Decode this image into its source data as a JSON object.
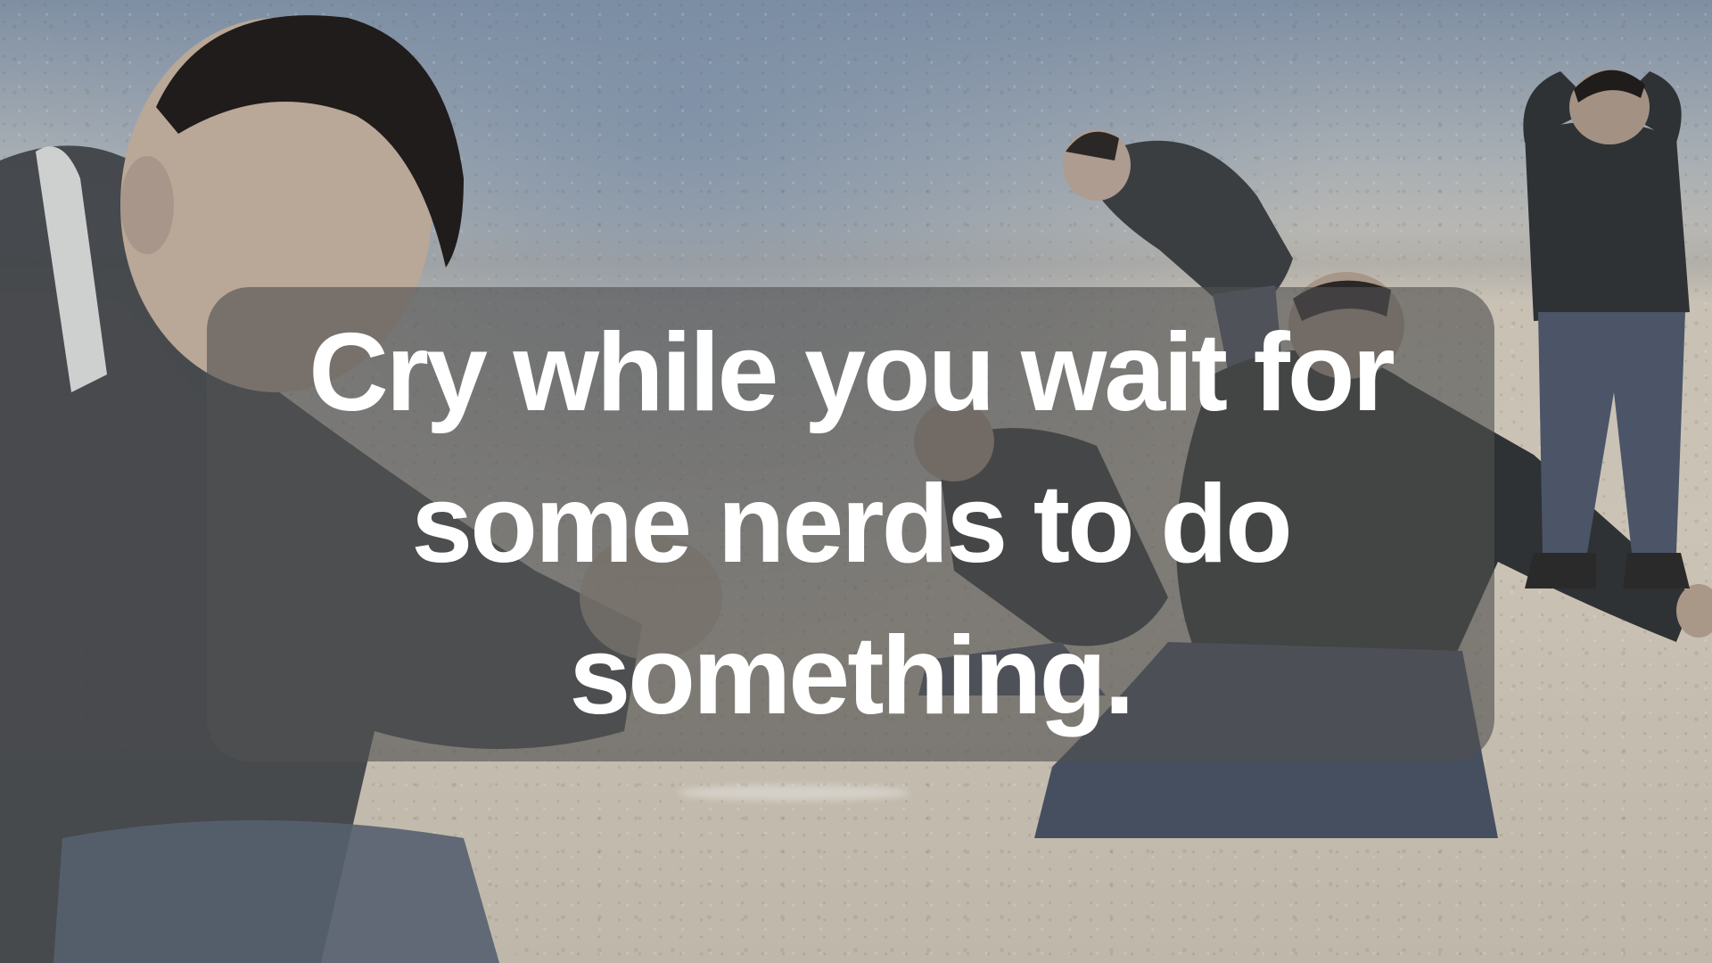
{
  "caption": {
    "line1": "Cry while you wait for",
    "line2": "some nerds to do",
    "line3": "something."
  },
  "colors": {
    "overlay": "#505050",
    "text": "#ffffff",
    "sand": "#c8c1b4",
    "sea": "#7f8fa3",
    "jacket": "#3a3d40",
    "jeans": "#4a5568"
  }
}
